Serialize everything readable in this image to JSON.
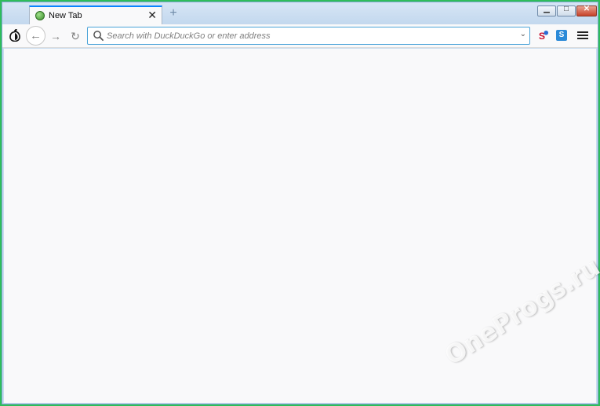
{
  "tab": {
    "title": "New Tab",
    "favicon": "globe-icon",
    "close_glyph": "✕"
  },
  "newtab_glyph": "+",
  "window_controls": {
    "minimize": "▁",
    "maximize": "□",
    "close": "✕"
  },
  "toolbar": {
    "back_glyph": "←",
    "forward_glyph": "→",
    "reload_glyph": "↻",
    "urlbar_placeholder": "Search with DuckDuckGo or enter address",
    "urlbar_value": "",
    "dropdown_glyph": "⌄",
    "extension_2_label": "S"
  },
  "watermark": "OneProgs.ru",
  "colors": {
    "accent": "#0a84ff",
    "frame": "#2ebd5a"
  }
}
